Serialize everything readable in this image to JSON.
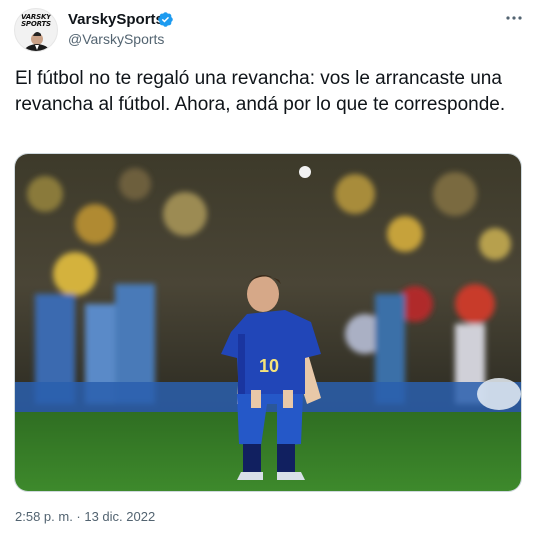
{
  "author": {
    "name": "VarskySports",
    "handle": "@VarskySports",
    "avatar_text": [
      "VARSKY",
      "SPORTS"
    ]
  },
  "tweet": {
    "text": "El fútbol no te regaló una revancha: vos le arrancaste una revancha al fútbol. Ahora, andá por lo que te corresponde.",
    "timestamp": "2:58 p. m. · 13 dic. 2022"
  },
  "photo": {
    "jersey_number": "10"
  },
  "icons": {
    "verified": "verified-badge-icon",
    "more": "more-options-icon"
  },
  "colors": {
    "verified": "#1d9bf0",
    "text": "#0f1419",
    "secondary": "#536471"
  }
}
